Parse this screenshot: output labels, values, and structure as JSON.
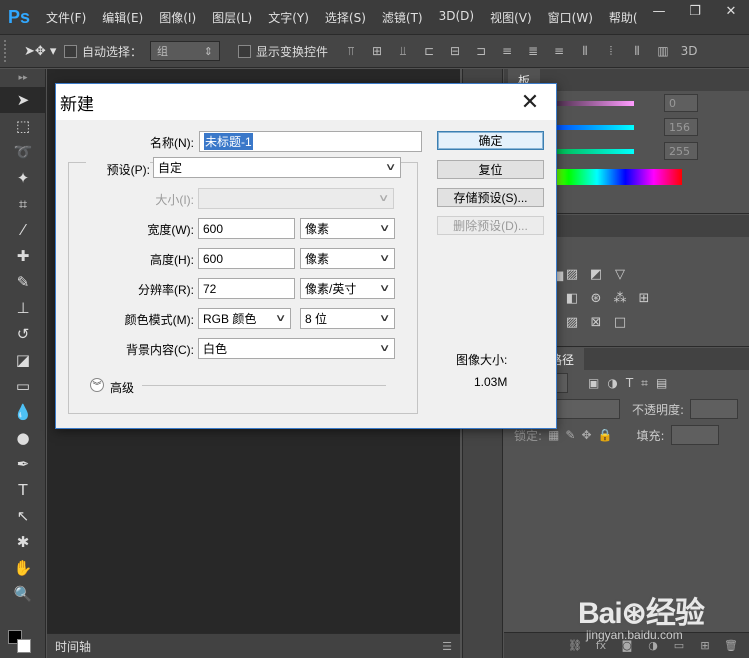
{
  "app": {
    "logo": "Ps",
    "menu": [
      "文件(F)",
      "编辑(E)",
      "图像(I)",
      "图层(L)",
      "文字(Y)",
      "选择(S)",
      "滤镜(T)",
      "3D(D)",
      "视图(V)",
      "窗口(W)",
      "帮助("
    ],
    "window_controls": [
      "—",
      "❐",
      "✕"
    ]
  },
  "options_bar": {
    "auto_select_label": "自动选择：",
    "auto_select_value": "组",
    "show_transform_label": "显示变换控件",
    "mode_3d_label": "3D"
  },
  "timeline": {
    "tab_label": "时间轴"
  },
  "right_panels": {
    "color_values": [
      "0",
      "156",
      "255"
    ],
    "color_tab_partial": "板",
    "styles_tab_partial": "式",
    "adjust_label_partial": "整",
    "layers_tabs": [
      "通道",
      "路径"
    ],
    "layers_tab_partial": "道",
    "opacity_label": "不透明度:",
    "lock_label": "锁定:",
    "fill_label": "填充:"
  },
  "dialog": {
    "title": "新建",
    "name_label": "名称(N):",
    "name_value": "未标题-1",
    "preset_label": "预设(P):",
    "preset_value": "自定",
    "size_label": "大小(I):",
    "width_label": "宽度(W):",
    "width_value": "600",
    "width_unit": "像素",
    "height_label": "高度(H):",
    "height_value": "600",
    "height_unit": "像素",
    "resolution_label": "分辨率(R):",
    "resolution_value": "72",
    "resolution_unit": "像素/英寸",
    "color_mode_label": "颜色模式(M):",
    "color_mode_value": "RGB 颜色",
    "bit_depth_value": "8 位",
    "background_label": "背景内容(C):",
    "background_value": "白色",
    "advanced_label": "高级",
    "ok_button": "确定",
    "reset_button": "复位",
    "save_preset_button": "存储预设(S)...",
    "delete_preset_button": "删除预设(D)...",
    "image_size_label": "图像大小:",
    "image_size_value": "1.03M"
  },
  "watermark": {
    "brand": "Bai⊛经验",
    "url": "jingyan.baidu.com"
  },
  "colors": {
    "ps_blue": "#31a8ff",
    "selection_blue": "#3a78c9",
    "dialog_border": "#3b7bc9"
  }
}
